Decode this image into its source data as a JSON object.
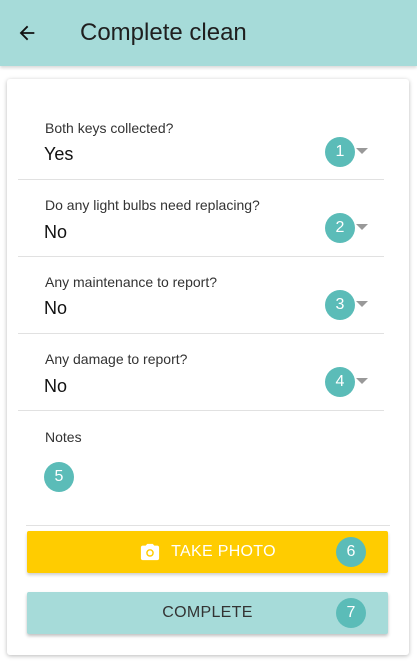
{
  "header": {
    "title": "Complete clean",
    "back_icon": "arrow-left-icon"
  },
  "form": {
    "fields": [
      {
        "label": "Both keys collected?",
        "value": "Yes",
        "badge": "1"
      },
      {
        "label": "Do any light bulbs need replacing?",
        "value": "No",
        "badge": "2"
      },
      {
        "label": "Any maintenance to report?",
        "value": "No",
        "badge": "3"
      },
      {
        "label": "Any damage to report?",
        "value": "No",
        "badge": "4"
      }
    ],
    "notes": {
      "label": "Notes",
      "badge": "5"
    }
  },
  "actions": {
    "take_photo": {
      "label": "TAKE PHOTO",
      "badge": "6",
      "icon": "camera-icon"
    },
    "complete": {
      "label": "COMPLETE",
      "badge": "7"
    }
  },
  "colors": {
    "appbar": "#a6dbd9",
    "badge": "#5bbcb8",
    "photo_button": "#ffcc00",
    "complete_button": "#a6dbd9"
  }
}
